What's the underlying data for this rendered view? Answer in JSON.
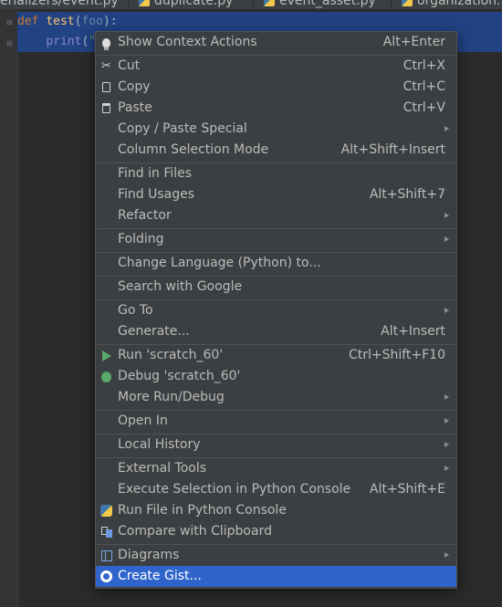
{
  "tabs": [
    {
      "label": "erializers/event.py"
    },
    {
      "label": "duplicate.py"
    },
    {
      "label": "event_asset.py"
    },
    {
      "label": "organization..."
    }
  ],
  "editor": {
    "line1": {
      "kw": "def",
      "fn": "test",
      "open": "(",
      "param": "foo",
      "close": "):"
    },
    "line2": {
      "indent": "    ",
      "bi": "print",
      "open": "(",
      "str": "\""
    }
  },
  "menu": {
    "items": [
      {
        "name": "show-context-actions",
        "label": "Show Context Actions",
        "shortcut": "Alt+Enter",
        "icon": "bulb-icon"
      },
      {
        "name": "cut",
        "label": "Cut",
        "shortcut": "Ctrl+X",
        "icon": "scissors-icon"
      },
      {
        "name": "copy",
        "label": "Copy",
        "shortcut": "Ctrl+C",
        "icon": "copy-icon"
      },
      {
        "name": "paste",
        "label": "Paste",
        "shortcut": "Ctrl+V",
        "icon": "clipboard-icon"
      },
      {
        "name": "copy-paste-special",
        "label": "Copy / Paste Special",
        "submenu": true
      },
      {
        "name": "column-selection-mode",
        "label": "Column Selection Mode",
        "shortcut": "Alt+Shift+Insert"
      },
      {
        "name": "find-in-files",
        "label": "Find in Files"
      },
      {
        "name": "find-usages",
        "label": "Find Usages",
        "shortcut": "Alt+Shift+7"
      },
      {
        "name": "refactor",
        "label": "Refactor",
        "submenu": true
      },
      {
        "name": "folding",
        "label": "Folding",
        "submenu": true
      },
      {
        "name": "change-language",
        "label": "Change Language (Python) to..."
      },
      {
        "name": "search-with-google",
        "label": "Search with Google"
      },
      {
        "name": "go-to",
        "label": "Go To",
        "submenu": true
      },
      {
        "name": "generate",
        "label": "Generate...",
        "shortcut": "Alt+Insert"
      },
      {
        "name": "run-scratch",
        "label": "Run 'scratch_60'",
        "shortcut": "Ctrl+Shift+F10",
        "icon": "run-icon"
      },
      {
        "name": "debug-scratch",
        "label": "Debug 'scratch_60'",
        "icon": "debug-icon"
      },
      {
        "name": "more-run-debug",
        "label": "More Run/Debug",
        "submenu": true
      },
      {
        "name": "open-in",
        "label": "Open In",
        "submenu": true
      },
      {
        "name": "local-history",
        "label": "Local History",
        "submenu": true
      },
      {
        "name": "external-tools",
        "label": "External Tools",
        "submenu": true
      },
      {
        "name": "execute-selection",
        "label": "Execute Selection in Python Console",
        "shortcut": "Alt+Shift+E"
      },
      {
        "name": "run-file-in-console",
        "label": "Run File in Python Console",
        "icon": "python-icon"
      },
      {
        "name": "compare-with-clipboard",
        "label": "Compare with Clipboard",
        "icon": "compare-icon"
      },
      {
        "name": "diagrams",
        "label": "Diagrams",
        "submenu": true,
        "icon": "diagram-icon"
      },
      {
        "name": "create-gist",
        "label": "Create Gist...",
        "icon": "github-icon",
        "selected": true
      }
    ]
  },
  "colors": {
    "menu_bg": "#3c3f41",
    "selection": "#2f65ca",
    "editor_bg": "#2b2b2b",
    "editor_selection": "#214283"
  }
}
